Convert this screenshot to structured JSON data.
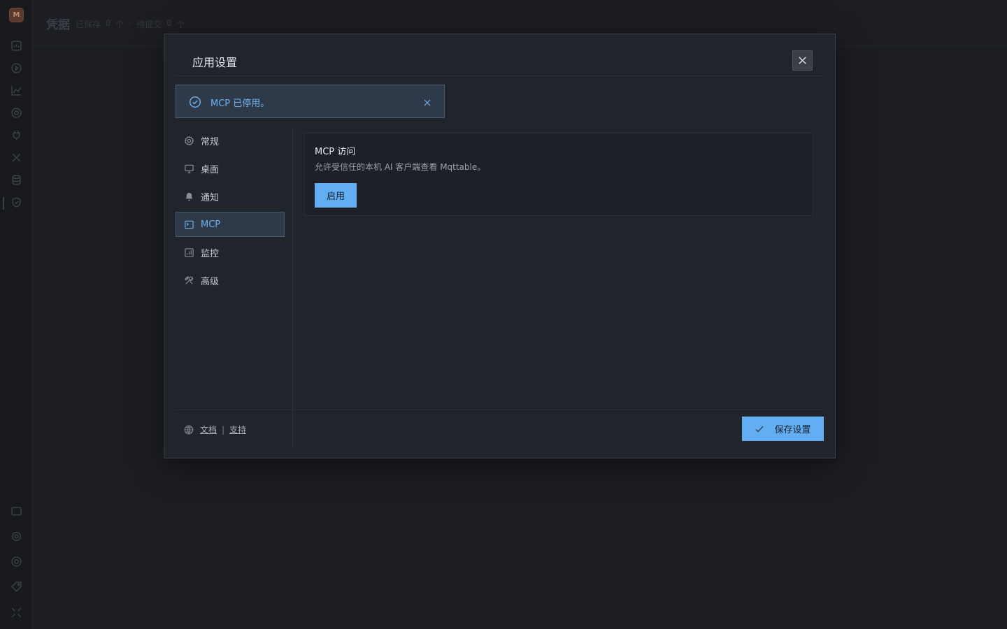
{
  "app": {
    "logo_text": "M",
    "header": {
      "title": "凭据",
      "saved_label": "已保存",
      "saved_count": "0",
      "saved_unit": "个",
      "dot": "·",
      "pending_label": "待提交",
      "pending_count": "0",
      "pending_unit": "个"
    },
    "rail_icons": [
      "dashboard-icon",
      "play-icon",
      "chart-icon",
      "target-icon",
      "plug-icon",
      "tools-icon",
      "database-icon",
      "shield-icon",
      "terminal-icon",
      "gear-icon",
      "help-icon",
      "tag-icon",
      "collapse-icon"
    ]
  },
  "modal": {
    "title": "应用设置",
    "toast": {
      "message": "MCP 已停用。",
      "status": "success"
    },
    "nav": [
      {
        "label": "常规",
        "icon": "gear-icon",
        "active": false
      },
      {
        "label": "桌面",
        "icon": "monitor-icon",
        "active": false
      },
      {
        "label": "通知",
        "icon": "bell-icon",
        "active": false
      },
      {
        "label": "MCP",
        "icon": "terminal-icon",
        "active": true
      },
      {
        "label": "监控",
        "icon": "chart-icon",
        "active": false
      },
      {
        "label": "高级",
        "icon": "tools-icon",
        "active": false
      }
    ],
    "mcp": {
      "title": "MCP 访问",
      "description": "允许受信任的本机 AI 客户端查看 Mqttable。",
      "enable_label": "启用"
    },
    "footer": {
      "docs_label": "文档",
      "separator": "|",
      "support_label": "支持",
      "save_label": "保存设置"
    }
  },
  "colors": {
    "accent": "#63adf2",
    "accent_text": "#6fb4f0",
    "modal_bg": "#20242b",
    "page_bg": "#1c1e23"
  }
}
